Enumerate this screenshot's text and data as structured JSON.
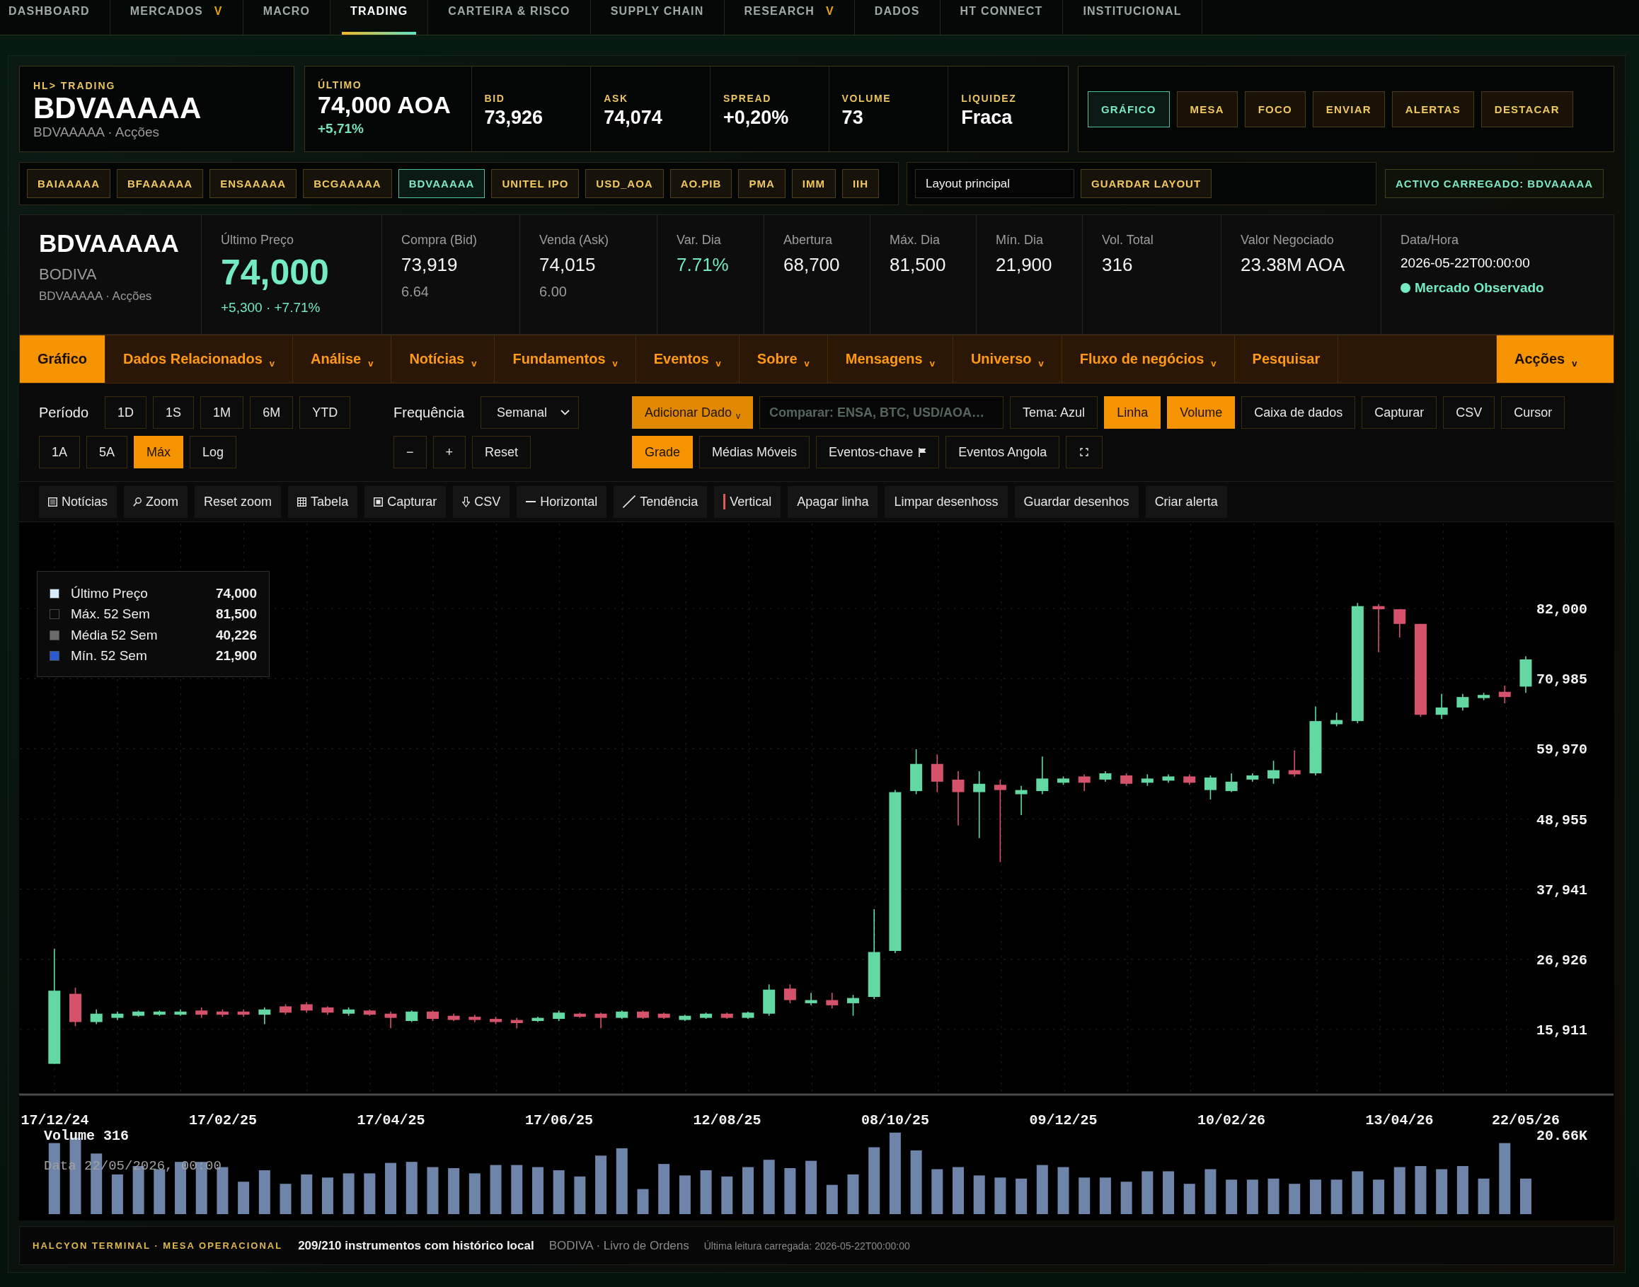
{
  "nav": [
    {
      "label": "DASHBOARD",
      "selected": false
    },
    {
      "label": "MERCADOS",
      "caret": "V",
      "selected": false
    },
    {
      "label": "MACRO",
      "selected": false
    },
    {
      "label": "TRADING",
      "selected": true
    },
    {
      "label": "CARTEIRA & RISCO",
      "selected": false
    },
    {
      "label": "SUPPLY CHAIN",
      "selected": false
    },
    {
      "label": "RESEARCH",
      "caret": "V",
      "selected": false
    },
    {
      "label": "DADOS",
      "selected": false
    },
    {
      "label": "HT CONNECT",
      "selected": false
    },
    {
      "label": "INSTITUCIONAL",
      "selected": false
    }
  ],
  "header": {
    "eyebrow": "HL> TRADING",
    "symbol": "BDVAAAAA",
    "subtitle": "BDVAAAAA · Acções"
  },
  "quote": {
    "last_label": "ÚLTIMO",
    "last_value": "74,000 AOA",
    "last_change": "+5,71%",
    "fields": [
      {
        "label": "BID",
        "value": "73,926"
      },
      {
        "label": "ASK",
        "value": "74,074"
      },
      {
        "label": "SPREAD",
        "value": "+0,20%"
      },
      {
        "label": "VOLUME",
        "value": "73"
      },
      {
        "label": "LIQUIDEZ",
        "value": "Fraca"
      }
    ]
  },
  "view_buttons": [
    {
      "label": "GRÁFICO",
      "selected": true
    },
    {
      "label": "MESA",
      "selected": false
    },
    {
      "label": "FOCO",
      "selected": false
    },
    {
      "label": "ENVIAR",
      "selected": false
    },
    {
      "label": "ALERTAS",
      "selected": false
    },
    {
      "label": "DESTACAR",
      "selected": false
    }
  ],
  "tickers": [
    {
      "label": "BAIAAAAA",
      "selected": false
    },
    {
      "label": "BFAAAAAA",
      "selected": false
    },
    {
      "label": "ENSAAAAA",
      "selected": false
    },
    {
      "label": "BCGAAAAA",
      "selected": false
    },
    {
      "label": "BDVAAAAA",
      "selected": true
    },
    {
      "label": "UNITEL IPO",
      "selected": false
    },
    {
      "label": "USD_AOA",
      "selected": false
    },
    {
      "label": "AO.PIB",
      "selected": false
    },
    {
      "label": "PMA",
      "selected": false
    },
    {
      "label": "IMM",
      "selected": false
    },
    {
      "label": "IIH",
      "selected": false
    }
  ],
  "layout": {
    "value": "Layout principal",
    "save": "GUARDAR LAYOUT"
  },
  "active_asset": "ACTIVO CARREGADO: BDVAAAAA",
  "summary": {
    "symbol": "BDVAAAAA",
    "exchange": "BODIVA",
    "subtitle": "BDVAAAAA · Acções",
    "last_label": "Último Preço",
    "last_value": "74,000",
    "last_change": "+5,300 · +7.71%",
    "stats": [
      {
        "label": "Compra (Bid)",
        "value": "73,919",
        "sub": "6.64",
        "positive": false
      },
      {
        "label": "Venda (Ask)",
        "value": "74,015",
        "sub": "6.00",
        "positive": false
      },
      {
        "label": "Var. Dia",
        "value": "7.71%",
        "positive": true
      },
      {
        "label": "Abertura",
        "value": "68,700",
        "positive": false
      },
      {
        "label": "Máx. Dia",
        "value": "81,500",
        "positive": false
      },
      {
        "label": "Mín. Dia",
        "value": "21,900",
        "positive": false
      },
      {
        "label": "Vol. Total",
        "value": "316",
        "positive": false
      },
      {
        "label": "Valor Negociado",
        "value": "23.38M AOA",
        "positive": false
      }
    ],
    "datetime": {
      "label": "Data/Hora",
      "value": "2026-05-22T00:00:00",
      "status": "Mercado Observado"
    }
  },
  "menu": {
    "items": [
      {
        "label": "Gráfico",
        "selected": true
      },
      {
        "label": "Dados Relacionados",
        "caret": "v",
        "selected": false
      },
      {
        "label": "Análise",
        "caret": "v",
        "selected": false
      },
      {
        "label": "Notícias",
        "caret": "v",
        "selected": false
      },
      {
        "label": "Fundamentos",
        "caret": "v",
        "selected": false
      },
      {
        "label": "Eventos",
        "caret": "v",
        "selected": false
      },
      {
        "label": "Sobre",
        "caret": "v",
        "selected": false
      },
      {
        "label": "Mensagens",
        "caret": "v",
        "selected": false
      },
      {
        "label": "Universo",
        "caret": "v",
        "selected": false
      },
      {
        "label": "Fluxo de negócios",
        "caret": "v",
        "selected": false
      },
      {
        "label": "Pesquisar",
        "selected": false
      }
    ],
    "asset_class": {
      "label": "Acções",
      "caret": "v"
    }
  },
  "controls": {
    "period": {
      "label": "Período",
      "buttons": [
        {
          "label": "1D",
          "selected": false
        },
        {
          "label": "1S",
          "selected": false
        },
        {
          "label": "1M",
          "selected": false
        },
        {
          "label": "6M",
          "selected": false
        },
        {
          "label": "YTD",
          "selected": false
        },
        {
          "label": "1A",
          "selected": false
        },
        {
          "label": "5A",
          "selected": false
        },
        {
          "label": "Máx",
          "selected": true
        },
        {
          "label": "Log",
          "selected": false
        }
      ]
    },
    "frequency": {
      "label": "Frequência",
      "value": "Semanal",
      "buttons": [
        "−",
        "+",
        "Reset"
      ]
    },
    "options": [
      [
        {
          "kind": "menu",
          "label": "Adicionar Dado",
          "caret": "v"
        },
        {
          "kind": "input",
          "placeholder": "Comparar: ENSA, BTC, USD/AOA…"
        },
        {
          "kind": "toggle",
          "label": "Tema: Azul",
          "selected": false
        },
        {
          "kind": "toggle",
          "label": "Linha",
          "selected": true
        },
        {
          "kind": "toggle",
          "label": "Volume",
          "selected": true
        },
        {
          "kind": "toggle",
          "label": "Caixa de dados",
          "selected": false
        },
        {
          "kind": "toggle",
          "label": "Capturar",
          "selected": false
        },
        {
          "kind": "toggle",
          "label": "CSV",
          "selected": false
        },
        {
          "kind": "toggle",
          "label": "Cursor",
          "selected": false
        }
      ],
      [
        {
          "kind": "toggle",
          "label": "Grade",
          "selected": true
        },
        {
          "kind": "toggle",
          "label": "Médias Móveis",
          "selected": false
        },
        {
          "kind": "flag",
          "label": "Eventos-chave",
          "selected": false
        },
        {
          "kind": "toggle",
          "label": "Eventos Angola",
          "selected": false
        },
        {
          "kind": "fullscreen"
        }
      ]
    ]
  },
  "toolbar": [
    {
      "kind": "list",
      "label": "Notícias"
    },
    {
      "kind": "search",
      "label": "Zoom"
    },
    {
      "kind": "plain",
      "label": "Reset zoom"
    },
    {
      "kind": "table",
      "label": "Tabela"
    },
    {
      "kind": "capture",
      "label": "Capturar"
    },
    {
      "kind": "download",
      "label": "CSV"
    },
    {
      "kind": "hline",
      "label": "Horizontal"
    },
    {
      "kind": "diagonal",
      "label": "Tendência"
    },
    {
      "kind": "vline",
      "label": "Vertical"
    },
    {
      "kind": "plain",
      "label": "Apagar linha"
    },
    {
      "kind": "plain",
      "label": "Limpar desenhoss"
    },
    {
      "kind": "plain",
      "label": "Guardar desenhos"
    },
    {
      "kind": "plain",
      "label": "Criar alerta"
    }
  ],
  "chart": {
    "legend": [
      {
        "label": "Último Preço",
        "value": "74,000",
        "color": "#d8ecff"
      },
      {
        "label": "Máx. 52 Sem",
        "value": "81,500",
        "color": "#0a0a0a"
      },
      {
        "label": "Média 52 Sem",
        "value": "40,226",
        "color": "#6b6b6b"
      },
      {
        "label": "Mín. 52 Sem",
        "value": "21,900",
        "color": "#2a5bd0"
      }
    ],
    "y_labels": [
      "82,000",
      "70,985",
      "59,970",
      "48,955",
      "37,941",
      "26,926",
      "15,911"
    ],
    "x_labels": [
      "17/12/24",
      "17/02/25",
      "17/04/25",
      "17/06/25",
      "12/08/25",
      "08/10/25",
      "09/12/25",
      "10/02/26",
      "13/04/26",
      "22/05/26"
    ],
    "volume_label": "Volume 316",
    "volume_date": "Data 22/05/2026, 00:00",
    "volume_max": "20.66K"
  },
  "status_bar": {
    "brand": "HALCYON TERMINAL · MESA OPERACIONAL",
    "instruments": "209/210 instrumentos com histórico local",
    "source": "BODIVA · Livro de Ordens",
    "last_read": "Última leitura carregada: 2026-05-22T00:00:00"
  }
}
